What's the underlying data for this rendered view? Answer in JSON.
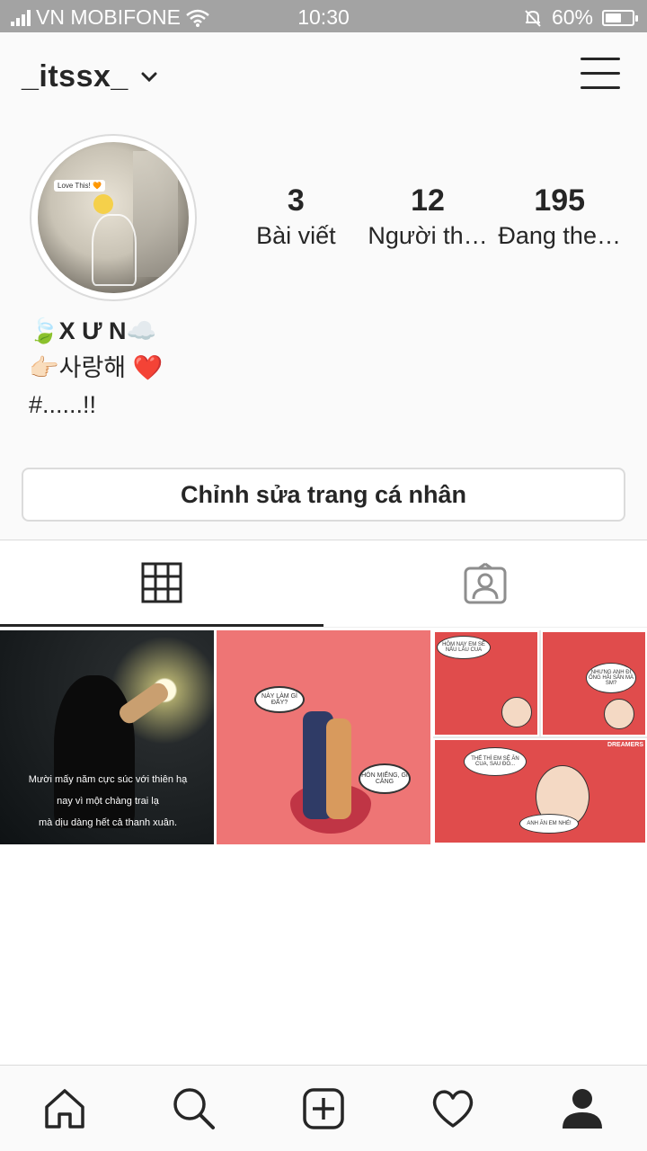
{
  "status_bar": {
    "carrier": "VN MOBIFONE",
    "time": "10:30",
    "battery": "60%",
    "battery_level": 0.6
  },
  "header": {
    "username": "_itssx_"
  },
  "profile": {
    "stats": [
      {
        "value": "3",
        "label": "Bài viết"
      },
      {
        "value": "12",
        "label": "Người th…"
      },
      {
        "value": "195",
        "label": "Đang the…"
      }
    ],
    "bio": {
      "name": "🍃X Ư N☁️",
      "line2": "👉🏻사랑해 ❤️",
      "line3": "#......!!"
    },
    "edit_button_label": "Chỉnh sửa trang cá nhân",
    "avatar_tag": "Love This! 🧡"
  },
  "tabs": [
    {
      "icon": "grid-icon",
      "active": true
    },
    {
      "icon": "tagged-person-icon",
      "active": false
    }
  ],
  "posts": [
    {
      "caption": "Mười mấy năm cực súc với thiên hạ\nnay vì một chàng trai lạ\nmà dịu dàng hết cả thanh xuân."
    },
    {
      "bubble1": "NÀY LÀM GÌ ĐẤY?",
      "bubble2": "HÔN MIẾNG, GÌ CĂNG"
    },
    {
      "bubble1": "HÔM NAY EM SẼ NẤU LẨU CUA",
      "bubble2": "NHƯNG ANH ĐI ỐNG HẢI SẢN MÀ SM?",
      "bubble3": "THẾ THÌ EM SẼ ĂN CUA, SAU ĐÓ...",
      "bubble4": "ANH ĂN EM NHÉ!",
      "brand": "DREAMERS"
    }
  ],
  "bottom_nav": [
    {
      "icon": "home-icon"
    },
    {
      "icon": "search-icon"
    },
    {
      "icon": "add-post-icon"
    },
    {
      "icon": "heart-icon"
    },
    {
      "icon": "profile-icon"
    }
  ],
  "colors": {
    "text": "#262626",
    "border": "#dbdbdb",
    "status_bar": "#a3a3a3",
    "background": "#fafafa"
  }
}
